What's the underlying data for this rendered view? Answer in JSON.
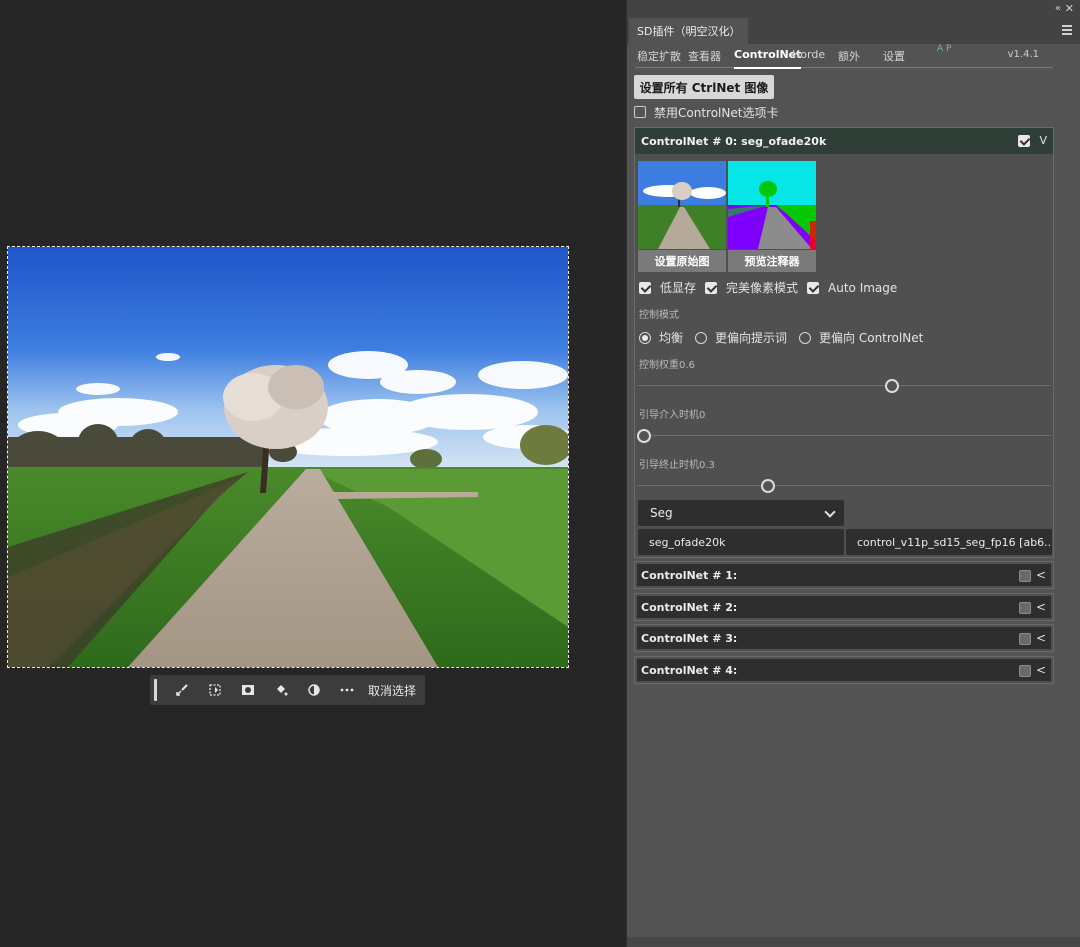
{
  "canvas": {
    "toolbar": {
      "tools": [
        "brush-select-icon",
        "transform-select-icon",
        "mask-icon",
        "fill-bucket-icon",
        "adjust-icon",
        "more-icon"
      ],
      "deselect_label": "取消选择"
    }
  },
  "panel": {
    "title": "SD插件（明空汉化）",
    "tabs": [
      "稳定扩散",
      "查看器",
      "ControlNet",
      "Horde",
      "额外",
      "设置"
    ],
    "active_tab": "ControlNet",
    "ap_mark": "A P",
    "version": "v1.4.1",
    "set_all_button": "设置所有 CtrlNet 图像",
    "disable_tab_label": "禁用ControlNet选项卡",
    "controlnets": [
      {
        "title": "ControlNet # 0: seg_ofade20k",
        "enabled": true,
        "set_original_button": "设置原始图",
        "preview_button": "预览注释器",
        "options": {
          "low_vram": "低显存",
          "pixel_perfect": "完美像素模式",
          "auto_image": "Auto Image"
        },
        "control_mode_label": "控制模式",
        "modes": [
          "均衡",
          "更偏向提示词",
          "更偏向 ControlNet"
        ],
        "selected_mode": "均衡",
        "weight_label": "控制权重0.6",
        "weight_value": 0.6,
        "start_label": "引导介入时机0",
        "start_value": 0,
        "end_label": "引导终止时机0.3",
        "end_value": 0.3,
        "module": "Seg",
        "preprocessor": "seg_ofade20k",
        "model": "control_v11p_sd15_seg_fp16 [ab6..."
      },
      {
        "title": "ControlNet # 1:",
        "enabled": false
      },
      {
        "title": "ControlNet # 2:",
        "enabled": false
      },
      {
        "title": "ControlNet # 3:",
        "enabled": false
      },
      {
        "title": "ControlNet # 4:",
        "enabled": false
      }
    ]
  },
  "colors": {
    "panel_bg": "#535353",
    "header_accent": "#2f3f37",
    "canvas_bg": "#262626"
  }
}
